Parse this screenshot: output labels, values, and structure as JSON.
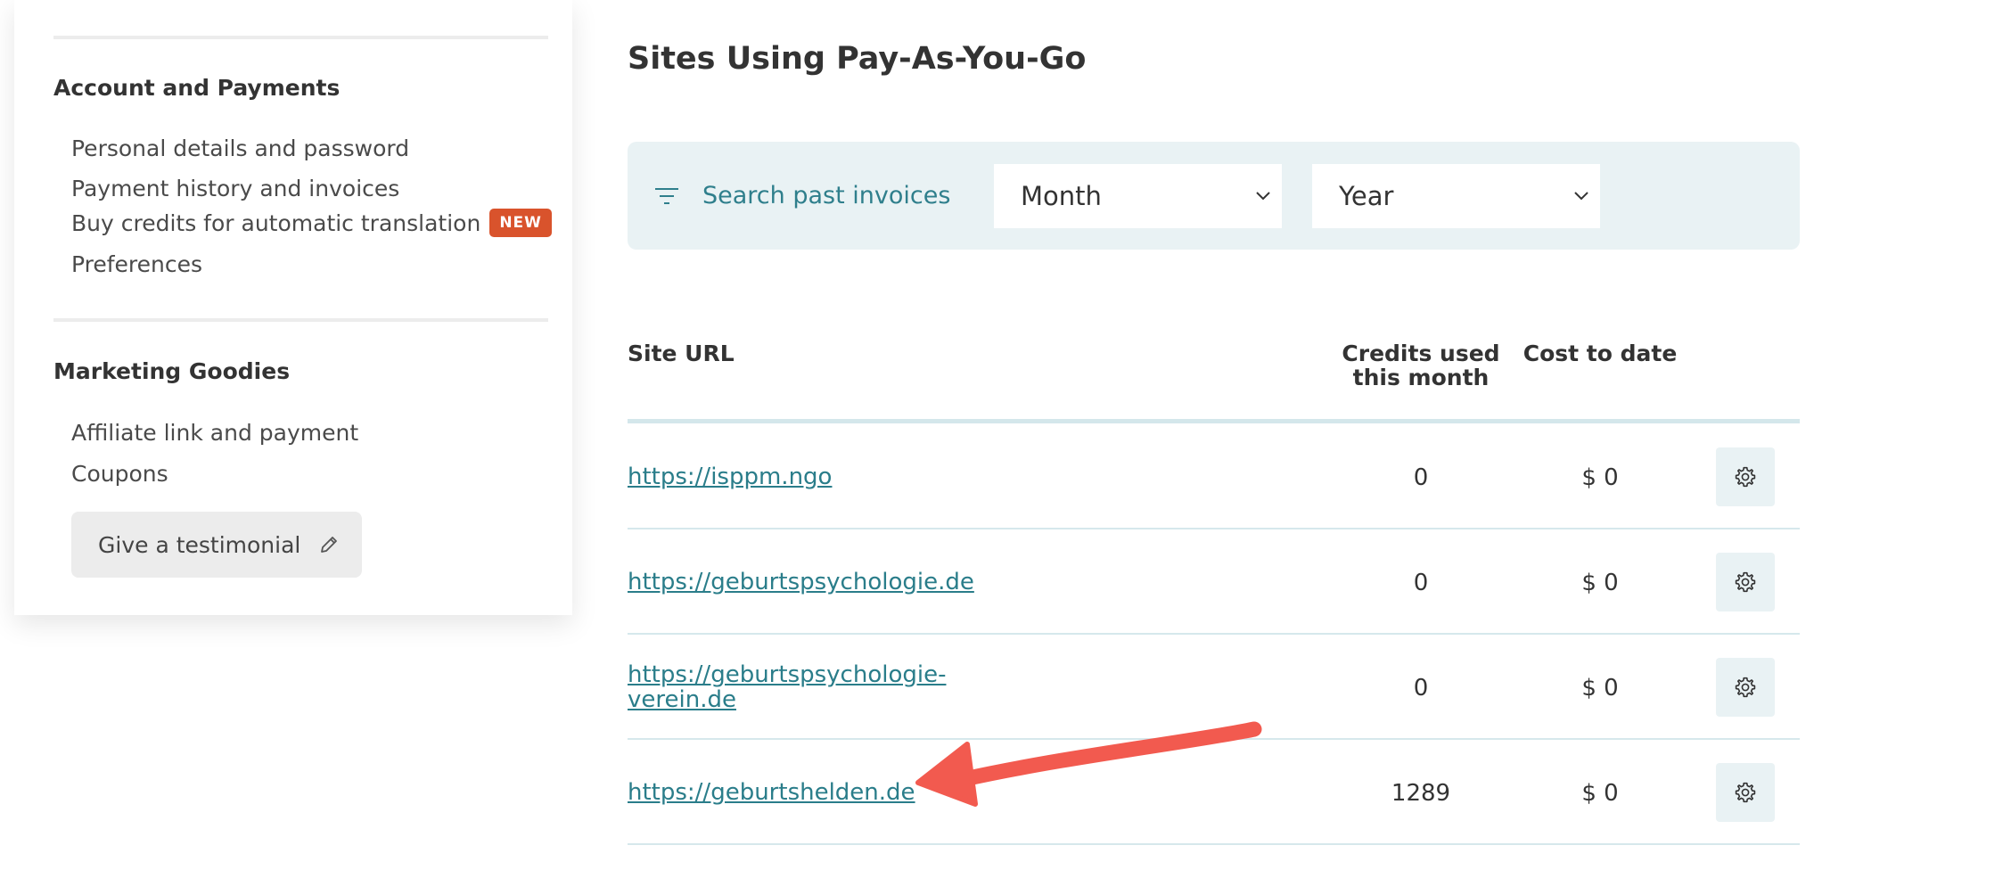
{
  "sidebar": {
    "account_title": "Account and Payments",
    "account_links": [
      {
        "label": "Personal details and password"
      },
      {
        "label": "Payment history and invoices"
      },
      {
        "label": "Buy credits for automatic translation",
        "badge": "NEW"
      },
      {
        "label": "Preferences"
      }
    ],
    "marketing_title": "Marketing Goodies",
    "marketing_links": [
      {
        "label": "Affiliate link and payment"
      },
      {
        "label": "Coupons"
      }
    ],
    "testimonial_button": "Give a testimonial",
    "badge_color": "#d9532c"
  },
  "main": {
    "title": "Sites Using Pay-As-You-Go",
    "filter": {
      "label": "Search past invoices",
      "month_value": "Month",
      "year_value": "Year"
    },
    "table": {
      "headers": {
        "site_url": "Site URL",
        "credits_line1": "Credits used",
        "credits_line2": "this month",
        "cost": "Cost to date"
      },
      "rows": [
        {
          "url_line1": "https://isppm.ngo",
          "url_line2": "",
          "credits": "0",
          "cost": "$ 0"
        },
        {
          "url_line1": "https://geburtspsychologie.de",
          "url_line2": "",
          "credits": "0",
          "cost": "$ 0"
        },
        {
          "url_line1": "https://geburtspsychologie-",
          "url_line2": "verein.de",
          "credits": "0",
          "cost": "$ 0"
        },
        {
          "url_line1": "https://geburtshelden.de",
          "url_line2": "",
          "credits": "1289",
          "cost": "$ 0"
        }
      ]
    },
    "accent_color": "#2a7d8a",
    "annotation_arrow_color": "#f25a4f"
  }
}
